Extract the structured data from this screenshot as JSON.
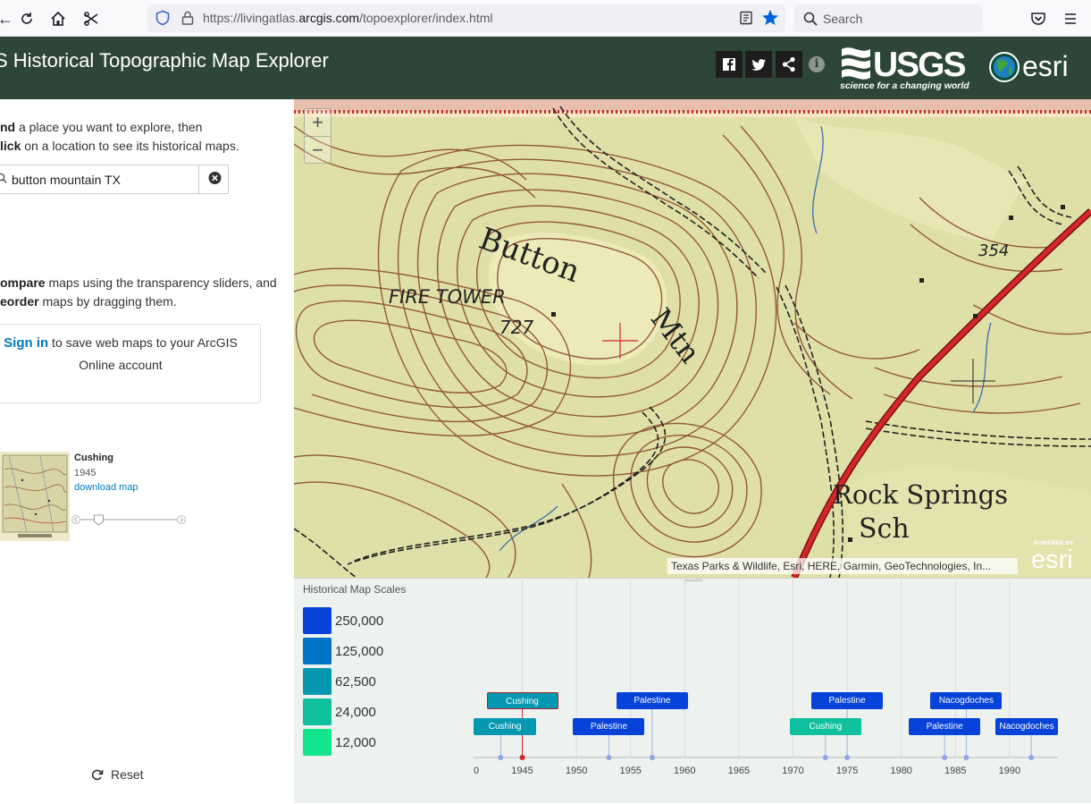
{
  "browser": {
    "url_prefix": "https://livingatlas.",
    "url_domain": "arcgis.com",
    "url_suffix": "/topoexplorer/index.html",
    "search_placeholder": "Search"
  },
  "header": {
    "title": "S Historical Topographic Map Explorer",
    "usgs_name": "USGS",
    "usgs_tagline": "science for a changing world",
    "esri_name": "esri"
  },
  "left": {
    "find_bold": "nd",
    "find_rest": " a place you want to explore, then",
    "click_bold": "lick",
    "click_rest": " on a location to see its historical maps.",
    "search_value": "button mountain TX",
    "compare_bold": "ompare",
    "compare_rest": " maps using the transparency sliders, and",
    "reorder_bold": "eorder",
    "reorder_rest": " maps by dragging them.",
    "signin_link": "Sign in",
    "signin_rest": " to save web maps to your ArcGIS",
    "signin_rest2": "Online account",
    "card": {
      "title": "Cushing",
      "year": "1945",
      "link": "download map",
      "opacity": 0.15
    },
    "reset_label": "Reset"
  },
  "map": {
    "zoom_in": "+",
    "zoom_out": "−",
    "labels": {
      "fire_tower": "FIRE TOWER",
      "elev_727": "727",
      "button": "Button",
      "mtn": "Mtn",
      "elev_354": "354",
      "rock_springs": "Rock Springs",
      "sch": "Sch"
    },
    "attribution": "Texas Parks & Wildlife, Esri, HERE, Garmin, GeoTechnologies, In...",
    "powered_by": "POWERED BY",
    "powered_esri": "esri"
  },
  "timeline": {
    "title": "Historical Map Scales",
    "scales": [
      {
        "label": "250,000",
        "color": "#0743d9"
      },
      {
        "label": "125,000",
        "color": "#0074c7"
      },
      {
        "label": "62,500",
        "color": "#0598b0"
      },
      {
        "label": "24,000",
        "color": "#0ec09d"
      },
      {
        "label": "12,000",
        "color": "#12e58b"
      }
    ],
    "axis_ticks": [
      "0",
      "1945",
      "1950",
      "1955",
      "1960",
      "1965",
      "1970",
      "1975",
      "1980",
      "1985",
      "1990"
    ],
    "maps": [
      {
        "name": "Cushing",
        "year": 1945,
        "row": 0,
        "scale": "62,500",
        "selected": true
      },
      {
        "name": "Cushing",
        "year": 1943,
        "row": 1,
        "scale": "62,500",
        "selected": false
      },
      {
        "name": "Palestine",
        "year": 1953,
        "row": 1,
        "scale": "250,000",
        "selected": false
      },
      {
        "name": "Palestine",
        "year": 1957,
        "row": 0,
        "scale": "250,000",
        "selected": false
      },
      {
        "name": "Cushing",
        "year": 1973,
        "row": 1,
        "scale": "24,000",
        "selected": false
      },
      {
        "name": "Palestine",
        "year": 1975,
        "row": 0,
        "scale": "250,000",
        "selected": false
      },
      {
        "name": "Palestine",
        "year": 1984,
        "row": 1,
        "scale": "250,000",
        "selected": false
      },
      {
        "name": "Nacogdoches",
        "year": 1986,
        "row": 0,
        "scale": "250,000",
        "selected": false
      },
      {
        "name": "Nacogdoches",
        "year": 1992,
        "row": 1,
        "scale": "250,000",
        "selected": false
      }
    ]
  }
}
